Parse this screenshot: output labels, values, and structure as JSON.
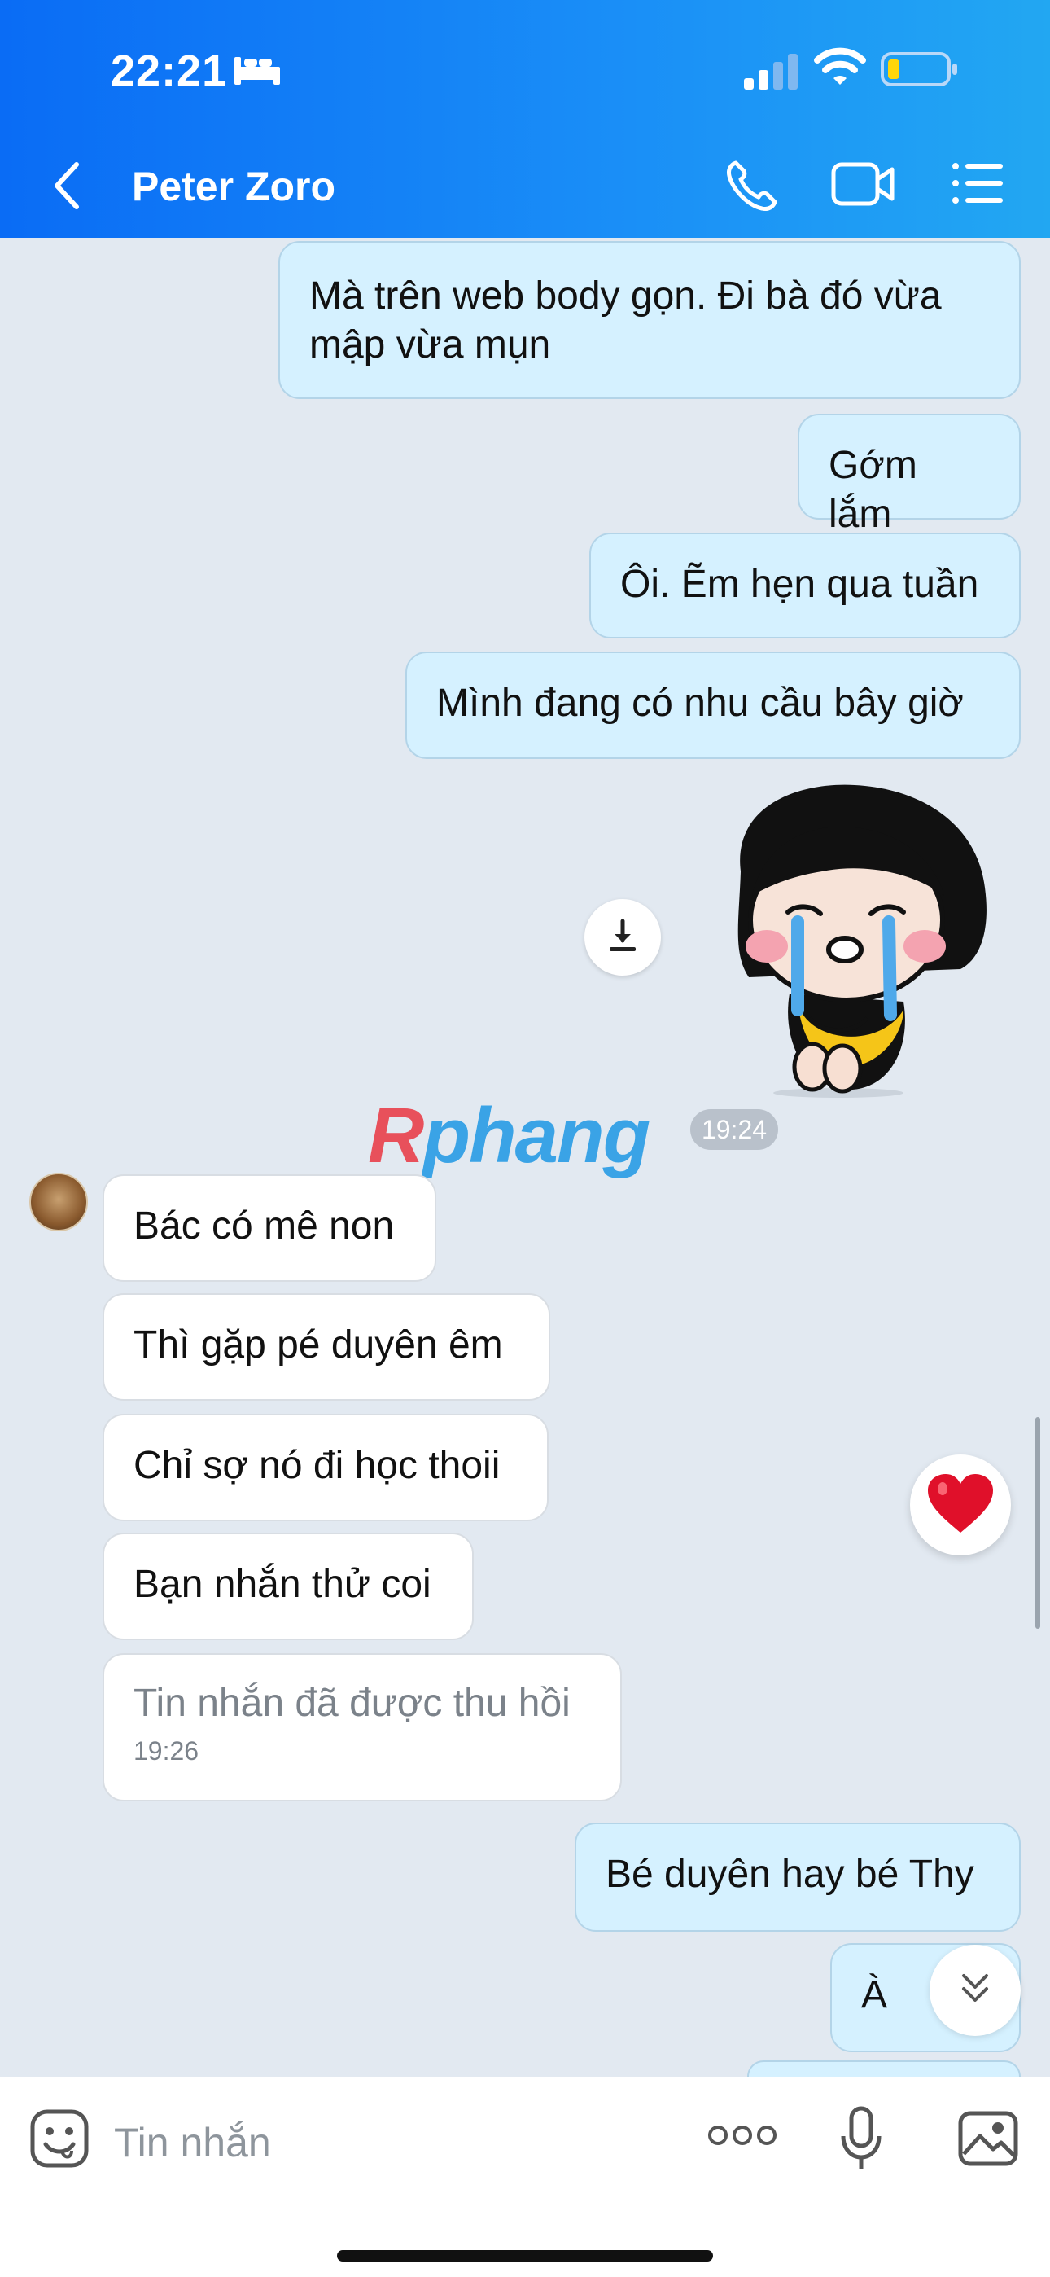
{
  "status_bar": {
    "time": "22:21"
  },
  "header": {
    "title": "Peter Zoro"
  },
  "messages_top": [
    {
      "text": "Mà trên web body gọn. Đi bà đó vừa mập vừa mụn"
    },
    {
      "text": "Gớm lắm"
    },
    {
      "text": "Ôi. Ẽm hẹn qua tuần"
    },
    {
      "text": "Mình đang có nhu cầu bây giờ"
    }
  ],
  "watermark": {
    "first": "R",
    "rest": "phang"
  },
  "time_divider": "19:24",
  "messages_in": [
    {
      "text": "Bác có mê non"
    },
    {
      "text": "Thì gặp pé duyên êm"
    },
    {
      "text": "Chỉ sợ nó đi học thoii"
    },
    {
      "text": "Bạn nhắn thử coi"
    }
  ],
  "recalled": {
    "text": "Tin nhắn đã được thu hồi",
    "time": "19:26"
  },
  "messages_bottom": [
    {
      "text": "Bé duyên hay bé Thy"
    },
    {
      "text": "À"
    }
  ],
  "input": {
    "placeholder": "Tin nhắn"
  },
  "icons": {
    "back": "chevron-left-icon",
    "phone": "phone-icon",
    "video": "video-call-icon",
    "menu": "list-menu-icon",
    "download": "download-icon",
    "heart": "heart-icon",
    "scroll_down": "double-chevron-down-icon",
    "emoji": "emoji-icon",
    "more": "more-icon",
    "mic": "microphone-icon",
    "image": "image-icon"
  },
  "colors": {
    "header_start": "#0a6cf5",
    "header_end": "#22a7f2",
    "outgoing_bubble": "#d5f1ff",
    "incoming_bubble": "#ffffff",
    "chat_bg": "#e2e9f1",
    "heart": "#e0102a"
  }
}
